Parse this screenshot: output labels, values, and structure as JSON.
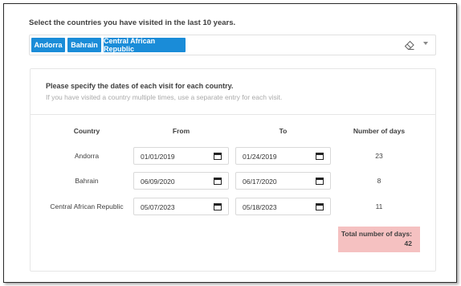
{
  "question": "Select the countries you have visited in the last 10 years.",
  "selected_tags": [
    "Andorra",
    "Bahrain",
    "Central African Republic"
  ],
  "tag_colors": {
    "background": "#1a8cd8",
    "text": "#ffffff"
  },
  "icons": {
    "clear": "eraser-icon",
    "dropdown": "chevron-down-icon",
    "date": "calendar-icon"
  },
  "panel": {
    "title": "Please specify the dates of each visit for each country.",
    "subtitle": "If you have visited a country multiple times, use a separate entry for each visit."
  },
  "table": {
    "headers": {
      "country": "Country",
      "from": "From",
      "to": "To",
      "days": "Number of days"
    },
    "rows": [
      {
        "country": "Andorra",
        "from": "01/01/2019",
        "to": "01/24/2019",
        "days": "23"
      },
      {
        "country": "Bahrain",
        "from": "06/09/2020",
        "to": "06/17/2020",
        "days": "8"
      },
      {
        "country": "Central African Republic",
        "from": "05/07/2023",
        "to": "05/18/2023",
        "days": "11"
      }
    ]
  },
  "total": {
    "label": "Total number of days:",
    "value": "42",
    "background": "#f5c1c1"
  }
}
